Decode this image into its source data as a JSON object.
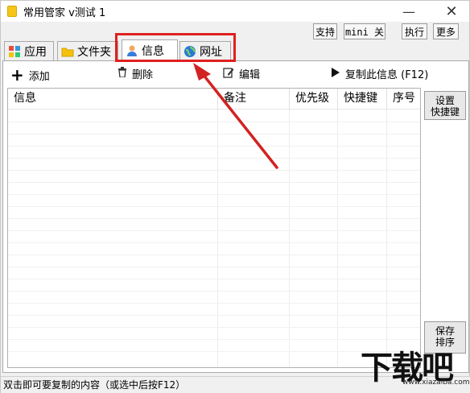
{
  "window": {
    "title": "常用管家 v测试 1",
    "min_label": "—",
    "close_label": "✕"
  },
  "toolbar": {
    "support": "支持",
    "mini": "mini 关",
    "run": "执行",
    "more": "更多"
  },
  "tabs": [
    {
      "label": "应用",
      "icon": "apps-icon"
    },
    {
      "label": "文件夹",
      "icon": "folder-icon"
    },
    {
      "label": "信息",
      "icon": "user-icon"
    },
    {
      "label": "网址",
      "icon": "globe-icon"
    }
  ],
  "actions": {
    "add": "添加",
    "delete": "删除",
    "edit": "编辑",
    "copy": "复制此信息 (F12)"
  },
  "table": {
    "columns": [
      "信息",
      "备注",
      "优先级",
      "快捷键",
      "序号"
    ],
    "rows": []
  },
  "side": {
    "set_hotkey": "设置\n快捷键",
    "save_order": "保存\n排序"
  },
  "status": "双击即可要复制的内容（或选中后按F12）",
  "watermark": {
    "brand": "下载吧",
    "url": "www.xiazaiba.com"
  },
  "colors": {
    "highlight": "#e02020",
    "arrow": "#d32222"
  }
}
